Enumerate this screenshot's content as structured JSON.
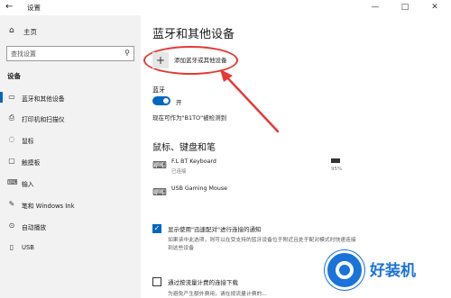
{
  "window": {
    "title": "设置",
    "back_icon": "back-arrow-icon",
    "minimize": "—",
    "maximize": "□",
    "close": "✕"
  },
  "sidebar": {
    "home_label": "主页",
    "search_placeholder": "查找设置",
    "section_title": "设备",
    "items": [
      {
        "label": "蓝牙和其他设备",
        "icon": "bluetooth-devices-icon",
        "selected": true
      },
      {
        "label": "打印机和扫描仪",
        "icon": "printer-icon"
      },
      {
        "label": "鼠标",
        "icon": "mouse-icon"
      },
      {
        "label": "触摸板",
        "icon": "touchpad-icon"
      },
      {
        "label": "输入",
        "icon": "keyboard-icon"
      },
      {
        "label": "笔和 Windows Ink",
        "icon": "pen-icon"
      },
      {
        "label": "自动播放",
        "icon": "autoplay-icon"
      },
      {
        "label": "USB",
        "icon": "usb-icon"
      }
    ]
  },
  "main": {
    "title": "蓝牙和其他设备",
    "add_device_label": "添加蓝牙或其他设备",
    "bluetooth_label": "蓝牙",
    "bluetooth_state": "开",
    "discoverable_text": "现在可作为\"B1TO\"被检测到",
    "devices_section_title": "鼠标、键盘和笔",
    "devices": [
      {
        "name": "F.L BT Keyboard",
        "status": "已连接",
        "battery": "95%",
        "battery_fraction": 0.95,
        "icon": "keyboard-icon"
      },
      {
        "name": "USB Gaming Mouse",
        "status": "",
        "icon": "keyboard-icon"
      }
    ],
    "swift_pair_label": "显示使用\"迅速配对\"进行连接的通知",
    "swift_pair_desc": "如果该中此选项，则可以在受支持的蓝牙设备位于附近且处于配对模式时快速连接到这些设备",
    "metered_label": "通过按流量计费的连接下载",
    "metered_desc": "为避免产生额外费用，请在按流量计费的..."
  },
  "colors": {
    "accent": "#0067c0",
    "highlight": "#e53935",
    "watermark": "#1a73d9"
  },
  "watermark": {
    "text": "好装机"
  }
}
